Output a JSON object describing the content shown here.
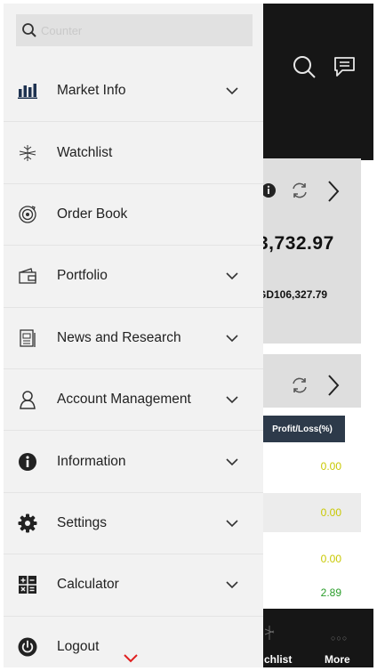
{
  "search": {
    "placeholder": "Counter"
  },
  "menu": {
    "items": [
      {
        "label": "Market Info",
        "icon": "bar-chart-icon",
        "expandable": true
      },
      {
        "label": "Watchlist",
        "icon": "watchlist-icon",
        "expandable": false
      },
      {
        "label": "Order Book",
        "icon": "order-book-icon",
        "expandable": false
      },
      {
        "label": "Portfolio",
        "icon": "wallet-icon",
        "expandable": true
      },
      {
        "label": "News and Research",
        "icon": "news-icon",
        "expandable": true
      },
      {
        "label": "Account Management",
        "icon": "user-icon",
        "expandable": true
      },
      {
        "label": "Information",
        "icon": "info-icon",
        "expandable": true
      },
      {
        "label": "Settings",
        "icon": "gear-icon",
        "expandable": true
      },
      {
        "label": "Calculator",
        "icon": "calculator-icon",
        "expandable": true
      },
      {
        "label": "Logout",
        "icon": "power-icon",
        "expandable": false
      }
    ]
  },
  "background": {
    "portfolio_value": "3,732.97",
    "portfolio_sub_value": "GD106,327.79",
    "table_header": "Profit/Loss(%)",
    "pl_values": [
      "0.00",
      "0.00",
      "0.00",
      "2.89"
    ],
    "bottom_nav": {
      "watchlist_label": "chlist",
      "more_label": "More",
      "more_dots": "○○○"
    }
  },
  "colors": {
    "drawer_bg": "#f2f2f2",
    "header_bg": "#161616",
    "card_bg": "#dedede",
    "table_header_bg": "#2d3a4a",
    "neutral_value": "#c8c800",
    "positive_value": "#2a9d2a",
    "caret_red": "#e02020"
  }
}
